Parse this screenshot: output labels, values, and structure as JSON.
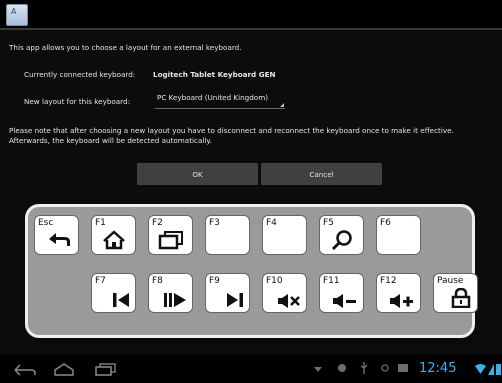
{
  "colors": {
    "accent_blue": "#3ab0e8",
    "panel_gray": "#9a9a9a",
    "button_gray": "#404040"
  },
  "titlebar": {
    "icon": "app-icon"
  },
  "intro": "This app allows you to choose a layout for an external keyboard.",
  "connected": {
    "label": "Currently connected keyboard:",
    "value": "Logitech Tablet Keyboard GEN"
  },
  "layout": {
    "label": "New layout for this keyboard:",
    "value": "PC Keyboard (United Kingdom)"
  },
  "note": {
    "line1": "Please note that after choosing a new layout you have to disconnect and reconnect the keyboard once to make it effective.",
    "line2": "Afterwards, the keyboard will be detected automatically."
  },
  "buttons": {
    "ok": "OK",
    "cancel": "Cancel"
  },
  "keyboard": {
    "row1": [
      "Esc",
      "F1",
      "F2",
      "F3",
      "F4",
      "F5",
      "F6"
    ],
    "row2": [
      "F7",
      "F8",
      "F9",
      "F10",
      "F11",
      "F12",
      "Pause"
    ]
  },
  "status": {
    "time": "12:45"
  }
}
